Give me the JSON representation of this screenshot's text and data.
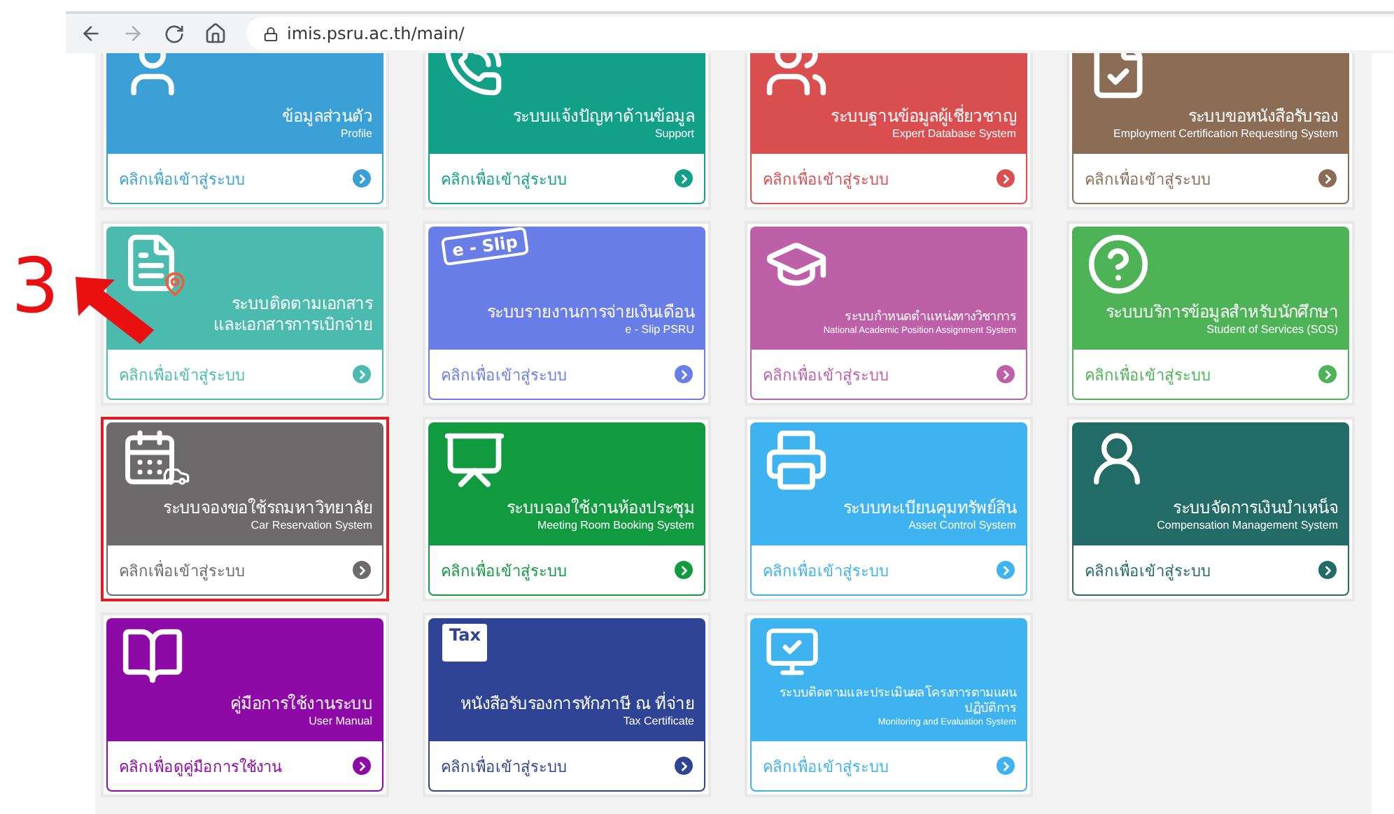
{
  "browser": {
    "url": "imis.psru.ac.th/main/",
    "forward_disabled": true
  },
  "annotation": {
    "label": "3"
  },
  "tiles": [
    {
      "title": "ข้อมูลส่วนตัว",
      "subtitle": "Profile",
      "link": "คลิกเพื่อเข้าสู่ระบบ",
      "color": "#3aa0d5",
      "kind": "profile",
      "small_title": false,
      "highlighted": false
    },
    {
      "title": "ระบบแจ้งปัญหาด้านข้อมูล",
      "subtitle": "Support",
      "link": "คลิกเพื่อเข้าสู่ระบบ",
      "color": "#12a088",
      "kind": "support",
      "small_title": false,
      "highlighted": false
    },
    {
      "title": "ระบบฐานข้อมูลผู้เชี่ยวชาญ",
      "subtitle": "Expert Database System",
      "link": "คลิกเพื่อเข้าสู่ระบบ",
      "color": "#d94f4f",
      "kind": "experts",
      "small_title": false,
      "highlighted": false
    },
    {
      "title": "ระบบขอหนังสือรับรอง",
      "subtitle": "Employment Certification Requesting System",
      "link": "คลิกเพื่อเข้าสู่ระบบ",
      "color": "#8b6c55",
      "kind": "certificate",
      "small_title": false,
      "highlighted": false
    },
    {
      "title": "ระบบติดตามเอกสาร\nและเอกสารการเบิกจ่าย",
      "link": "คลิกเพื่อเข้าสู่ระบบ",
      "color": "#4bbbb0",
      "kind": "document",
      "small_title": false,
      "highlighted": false
    },
    {
      "title": "ระบบรายงานการจ่ายเงินเดือน",
      "subtitle": "e - Slip PSRU",
      "link": "คลิกเพื่อเข้าสู่ระบบ",
      "color": "#6a7ee8",
      "kind": "slip",
      "icon_text": "e - Slip",
      "small_title": false,
      "highlighted": false
    },
    {
      "title": "ระบบกำหนดตำแหน่งทางวิชาการ",
      "subtitle": "National Academic Position Assignment System",
      "link": "คลิกเพื่อเข้าสู่ระบบ",
      "color": "#bd60a8",
      "kind": "graduate",
      "small_title": true,
      "highlighted": false
    },
    {
      "title": "ระบบบริการข้อมูลสำหรับนักศึกษา",
      "subtitle": "Student of Services (SOS)",
      "link": "คลิกเพื่อเข้าสู่ระบบ",
      "color": "#4db356",
      "kind": "question",
      "small_title": false,
      "highlighted": false
    },
    {
      "title": "ระบบจองขอใช้รถมหาวิทยาลัย",
      "subtitle": "Car Reservation System",
      "link": "คลิกเพื่อเข้าสู่ระบบ",
      "color": "#6d6a6b",
      "kind": "calendar",
      "small_title": false,
      "highlighted": true
    },
    {
      "title": "ระบบจองใช้งานห้องประชุม",
      "subtitle": "Meeting Room Booking System",
      "link": "คลิกเพื่อเข้าสู่ระบบ",
      "color": "#119a3f",
      "kind": "meeting",
      "small_title": false,
      "highlighted": false
    },
    {
      "title": "ระบบทะเบียนคุมทรัพย์สิน",
      "subtitle": "Asset Control System",
      "link": "คลิกเพื่อเข้าสู่ระบบ",
      "color": "#3fb2f0",
      "kind": "assets",
      "small_title": false,
      "highlighted": false
    },
    {
      "title": "ระบบจัดการเงินบำเหน็จ",
      "subtitle": "Compensation Management  System",
      "link": "คลิกเพื่อเข้าสู่ระบบ",
      "color": "#236b66",
      "kind": "people",
      "small_title": false,
      "highlighted": false
    },
    {
      "title": "คู่มือการใช้งานระบบ",
      "subtitle": "User Manual",
      "link": "คลิกเพื่อดูคู่มือการใช้งาน",
      "color": "#8e0aa6",
      "kind": "book",
      "small_title": false,
      "highlighted": false
    },
    {
      "title": "หนังสือรับรองการหักภาษี ณ ที่จ่าย",
      "subtitle": "Tax Certificate",
      "link": "คลิกเพื่อเข้าสู่ระบบ",
      "color": "#2f4495",
      "kind": "tax",
      "icon_text": "Tax",
      "small_title": false,
      "highlighted": false
    },
    {
      "title": "ระบบติดตามและประเมินผลโครงการตามแผนปฏิบัติการ",
      "subtitle": "Monitoring and Evaluation System",
      "link": "คลิกเพื่อเข้าสู่ระบบ",
      "color": "#3fb2f0",
      "kind": "monitor",
      "small_title": true,
      "highlighted": false
    }
  ]
}
